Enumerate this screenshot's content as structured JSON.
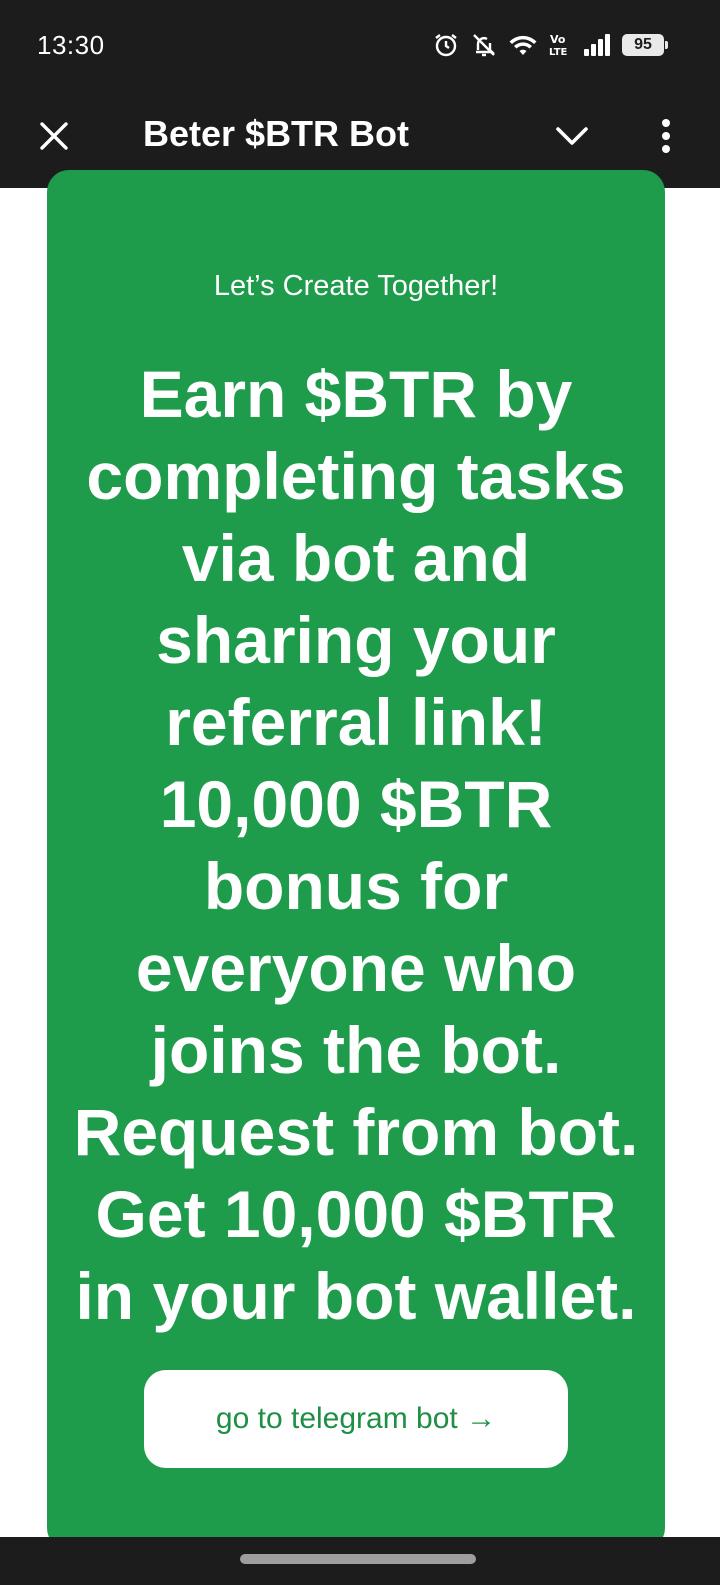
{
  "status_bar": {
    "time": "13:30",
    "battery": "95",
    "icons": [
      "alarm-icon",
      "bell-off-icon",
      "wifi-icon",
      "volte-icon",
      "signal-icon",
      "battery-icon"
    ]
  },
  "app_bar": {
    "title": "Beter $BTR Bot",
    "icons": [
      "close-icon",
      "chevron-down-icon",
      "more-vertical-icon"
    ]
  },
  "promo": {
    "eyebrow": "Let’s Create Together!",
    "headline_lines": [
      "Earn $BTR by",
      "completing tasks",
      "via bot and",
      "sharing your",
      "referral link!",
      "10,000 $BTR",
      "bonus for",
      "everyone who",
      "joins the bot.",
      "Request from bot.",
      "Get 10,000 $BTR",
      "in your bot wallet."
    ],
    "cta_label": "go to telegram bot →",
    "colors": {
      "card_background": "#1e9b4b",
      "cta_text": "#1e8f45"
    }
  }
}
